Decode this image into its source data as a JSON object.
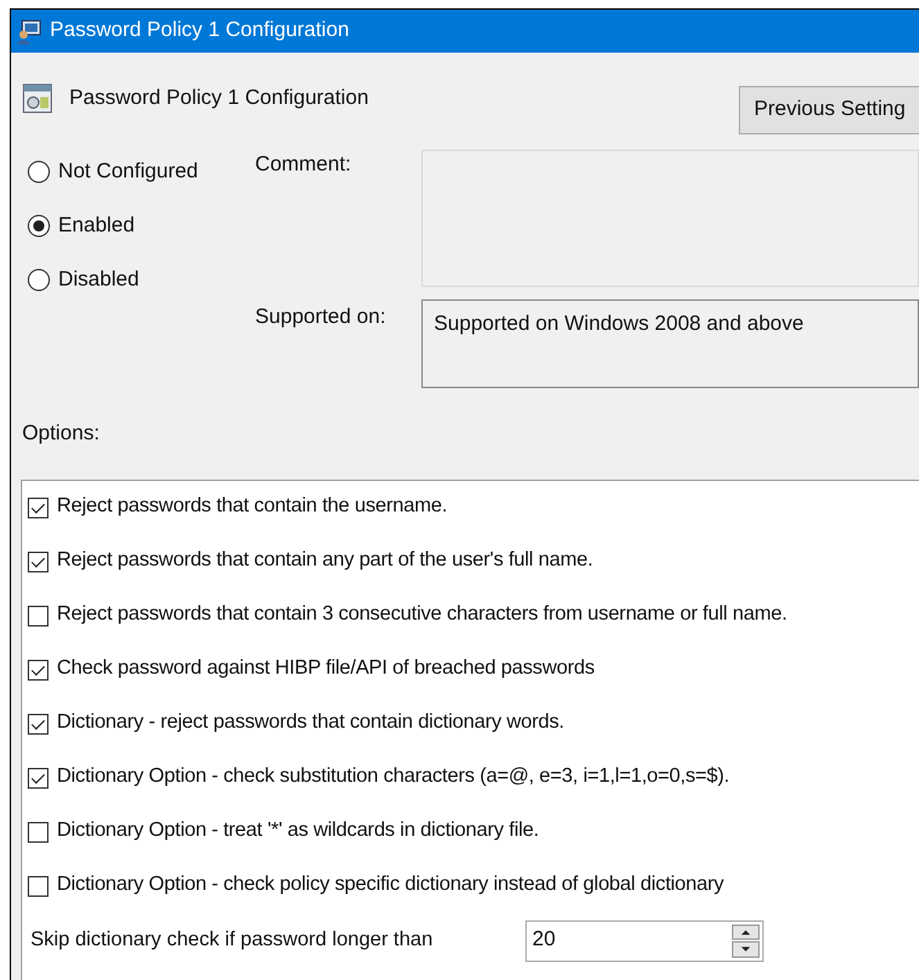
{
  "window": {
    "title": "Password Policy 1 Configuration"
  },
  "header": {
    "title": "Password Policy 1 Configuration"
  },
  "nav_buttons": [
    {
      "label": "Previous Setting"
    }
  ],
  "state_radios": [
    {
      "label": "Not Configured",
      "selected": false
    },
    {
      "label": "Enabled",
      "selected": true
    },
    {
      "label": "Disabled",
      "selected": false
    }
  ],
  "comment": {
    "label": "Comment:"
  },
  "supported_on": {
    "label": "Supported on:",
    "value": "Supported on Windows 2008 and above"
  },
  "options_label": "Options:",
  "options": [
    {
      "kind": "checkbox",
      "label": "Reject passwords that contain the username.",
      "checked": true
    },
    {
      "kind": "checkbox",
      "label": "Reject passwords that contain any part of the user's full name.",
      "checked": true
    },
    {
      "kind": "checkbox",
      "label": "Reject passwords that contain 3  consecutive characters from username or full name.",
      "checked": false
    },
    {
      "kind": "checkbox",
      "label": "Check password against HIBP file/API of breached passwords",
      "checked": true
    },
    {
      "kind": "checkbox",
      "label": "Dictionary - reject passwords that contain dictionary words.",
      "checked": true
    },
    {
      "kind": "checkbox",
      "label": "Dictionary Option - check substitution characters (a=@, e=3, i=1,l=1,o=0,s=$).",
      "checked": true
    },
    {
      "kind": "checkbox",
      "label": "Dictionary Option - treat '*' as wildcards in dictionary file.",
      "checked": false
    },
    {
      "kind": "checkbox",
      "label": "Dictionary Option - check policy specific dictionary instead of global dictionary",
      "checked": false
    },
    {
      "kind": "number",
      "label": "Skip dictionary check if password longer than",
      "value": "20"
    }
  ]
}
